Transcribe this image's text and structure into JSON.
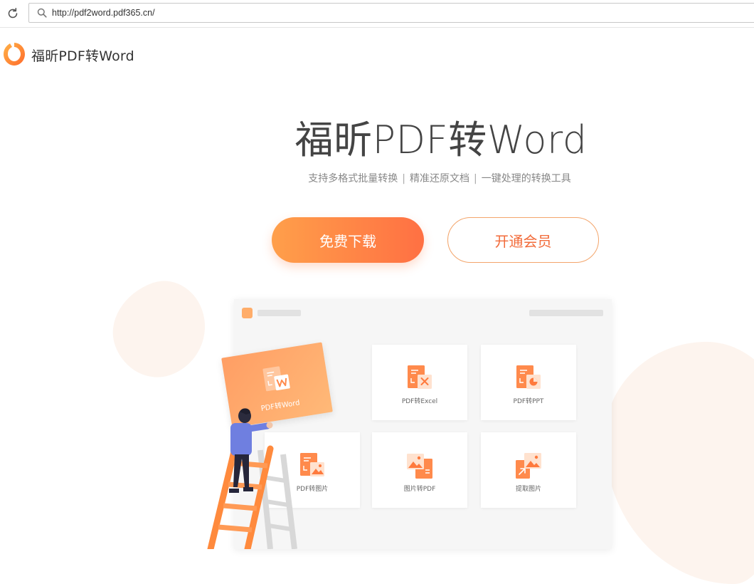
{
  "browser": {
    "url": "http://pdf2word.pdf365.cn/"
  },
  "header": {
    "brand": "福昕PDF转Word"
  },
  "hero": {
    "title": "福昕PDF转Word",
    "tagline": [
      "支持多格式批量转换",
      "精准还原文档",
      "一键处理的转换工具"
    ],
    "separator": "|",
    "download_label": "免费下载",
    "member_label": "开通会员"
  },
  "features": {
    "word": "PDF转Word",
    "excel": "PDF转Excel",
    "ppt": "PDF转PPT",
    "pdf_to_image": "PDF转图片",
    "image_to_pdf": "图片转PDF",
    "extract_image": "提取图片"
  },
  "colors": {
    "accent": "#ff7043",
    "accent_light": "#ffad6a",
    "text_dark": "#444444"
  }
}
